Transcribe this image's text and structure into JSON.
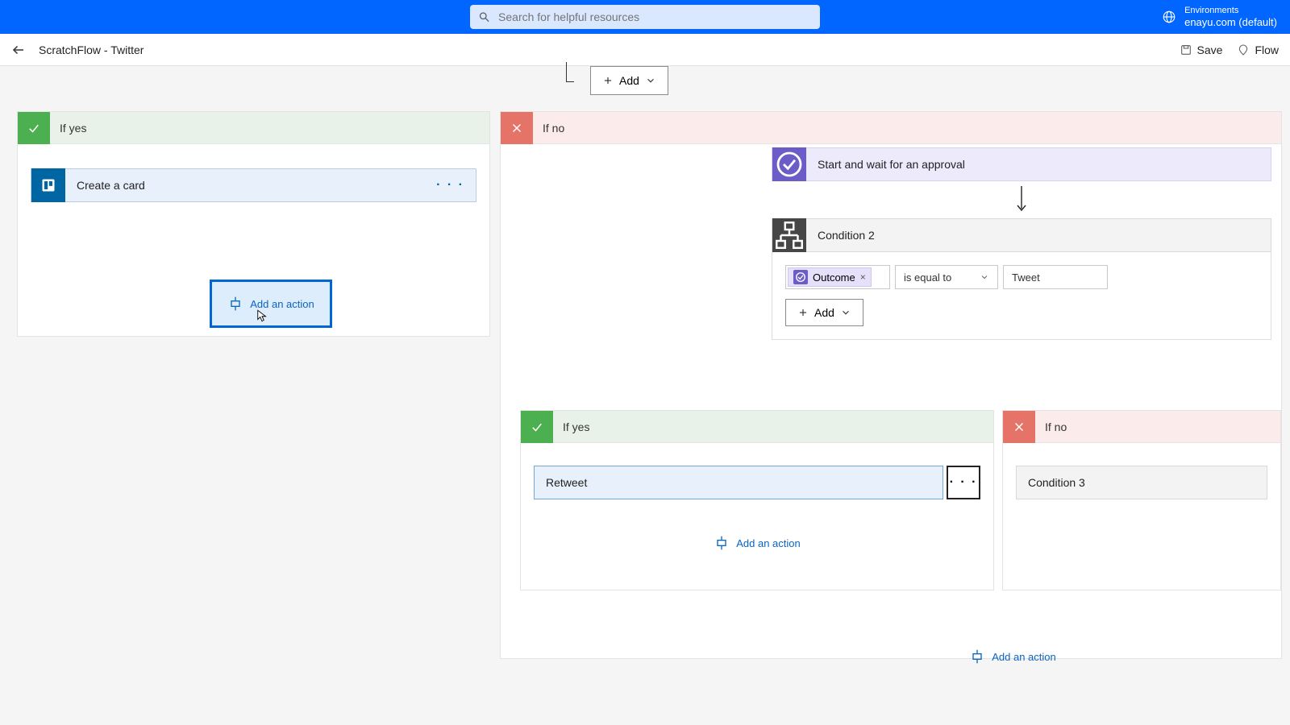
{
  "header": {
    "search_placeholder": "Search for helpful resources",
    "env_label_top": "Environments",
    "env_label_bottom": "enayu.com (default)"
  },
  "toolbar": {
    "flow_name": "ScratchFlow - Twitter",
    "save_label": "Save",
    "flow_label": "Flow"
  },
  "top_add": {
    "label": "Add"
  },
  "branch_outer_yes": {
    "header": "If yes",
    "action": {
      "label": "Create a card"
    },
    "add_action": "Add an action"
  },
  "branch_outer_no": {
    "header": "If no",
    "approval": {
      "label": "Start and wait for an approval"
    },
    "condition2": {
      "title": "Condition 2",
      "token_label": "Outcome",
      "operator": "is equal to",
      "value": "Tweet",
      "add_label": "Add"
    },
    "nested_yes": {
      "header": "If yes",
      "action": {
        "label": "Retweet"
      },
      "add_action": "Add an action"
    },
    "nested_no": {
      "header": "If no",
      "condition3": {
        "title": "Condition 3"
      }
    },
    "bottom_add_action": "Add an action"
  }
}
